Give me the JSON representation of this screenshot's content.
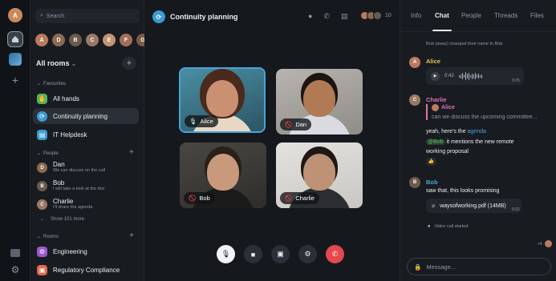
{
  "spacebar": {
    "user_initial": "A",
    "items": [
      {
        "name": "home",
        "icon": "home-icon"
      },
      {
        "name": "space",
        "icon": "space-icon"
      }
    ]
  },
  "roomlist": {
    "search_placeholder": "Search",
    "favourite_people": [
      "A",
      "D",
      "B",
      "C",
      "E",
      "F",
      "G"
    ],
    "header": "All rooms",
    "sections": {
      "favourites": "Favourites",
      "people": "People",
      "rooms": "Rooms"
    },
    "favourites": [
      {
        "name": "All hands",
        "color": "#53b35f",
        "icon": "✋"
      },
      {
        "name": "Continuity planning",
        "color": "#3b9bd3",
        "icon": "⟳"
      },
      {
        "name": "IT Helpdesk",
        "color": "#3b9bd3",
        "icon": "🖥"
      }
    ],
    "people": [
      {
        "name": "Dan",
        "preview": "We can discuss on the call",
        "color": "#8a6a52"
      },
      {
        "name": "Bob",
        "preview": "I will take a look at the doc",
        "color": "#6b5a4c"
      },
      {
        "name": "Charlie",
        "preview": "I'll share the agenda",
        "color": "#9a7866"
      }
    ],
    "show_more": "Show 101 more",
    "rooms": [
      {
        "name": "Engineering",
        "color": "#9b59d0",
        "icon": "⚙"
      },
      {
        "name": "Regulatory Compliance",
        "color": "#e06a4a",
        "icon": "▣"
      }
    ]
  },
  "call": {
    "title": "Continuity planning",
    "participant_count": "10",
    "participants": [
      {
        "name": "Alice",
        "muted": false,
        "speaking": true,
        "bg": "#3c6f83",
        "skin": "#c99072",
        "hair": "#4a2a1c",
        "shirt": "#e7d8c4"
      },
      {
        "name": "Dan",
        "muted": true,
        "speaking": false,
        "bg": "#a9a6a2",
        "skin": "#b07a55",
        "hair": "#1c1410",
        "shirt": "#d9dbe0"
      },
      {
        "name": "Bob",
        "muted": true,
        "speaking": false,
        "bg": "#3f3d3a",
        "skin": "#c89a7b",
        "hair": "#2a2018",
        "shirt": "#1b1b1c"
      },
      {
        "name": "Charlie",
        "muted": true,
        "speaking": false,
        "bg": "#d9d7d4",
        "skin": "#bd9275",
        "hair": "#1f1915",
        "shirt": "#2b2d31"
      }
    ]
  },
  "panel": {
    "tabs": [
      "Info",
      "Chat",
      "People",
      "Threads",
      "Files"
    ],
    "active_tab": "Chat",
    "notice": "Bob (away) changed their name to Bob",
    "messages": {
      "alice": {
        "sender": "Alice",
        "duration": "0:42",
        "time": "9:25"
      },
      "charlie": {
        "sender": "Charlie",
        "quote_sender": "Alice",
        "quote_text": "can we discuss the upcoming committee...",
        "line1_prefix": "yeah, here's the ",
        "line1_link": "agenda",
        "mention": "@Bob",
        "line2_rest": " it mentions the new remote",
        "line3": "working proposal",
        "reaction": "👍"
      },
      "bob": {
        "sender": "Bob",
        "text": "saw that, this looks promising",
        "file": "waysofworking.pdf (14MB)",
        "time": "9:32"
      }
    },
    "call_started": "Video call started",
    "read_receipt_count": "+4",
    "composer_placeholder": "Message..."
  },
  "colors": {
    "accent": "#4aa3d8",
    "hangup": "#e5484d",
    "alice": "#e5c85a",
    "charlie": "#e06fb3",
    "bob": "#4aa3d8"
  }
}
